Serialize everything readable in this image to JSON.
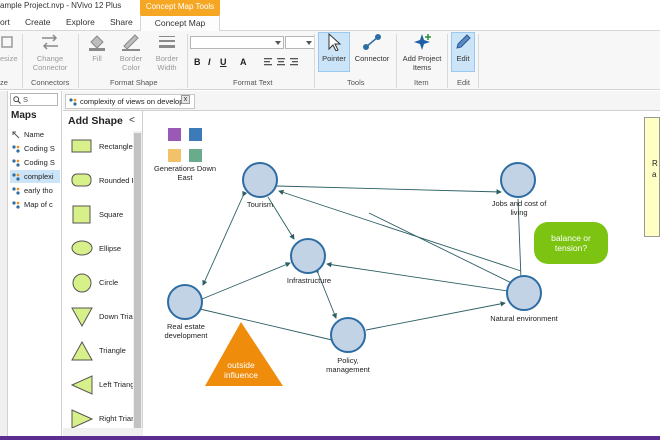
{
  "window": {
    "title": "ample Project.nvp - NVivo 12 Plus",
    "context_tab": "Concept Map Tools"
  },
  "menu": {
    "items": [
      "ort",
      "Create",
      "Explore",
      "Share"
    ],
    "active_tab": "Concept Map"
  },
  "ribbon": {
    "resize_label": "esize",
    "resize_group": "ze",
    "change_connector_label": "Change Connector",
    "connectors_group": "Connectors",
    "fill_label": "Fill",
    "border_color_label": "Border Color",
    "border_width_label": "Border Width",
    "format_shape_group": "Format Shape",
    "font_value": "",
    "size_value": "",
    "bold": "B",
    "italic": "I",
    "underline": "U",
    "font_color": "A",
    "format_text_group": "Format Text",
    "pointer_label": "Pointer",
    "connector_label": "Connector",
    "tools_group": "Tools",
    "add_items_label": "Add Project Items",
    "item_group": "Item",
    "edit_label": "Edit",
    "edit_group": "Edit"
  },
  "maps_panel": {
    "search_value": "S",
    "title": "Maps",
    "header": "Name",
    "rows": [
      {
        "label": "Coding S",
        "selected": false
      },
      {
        "label": "Coding S",
        "selected": false
      },
      {
        "label": "complexi",
        "selected": true
      },
      {
        "label": "early tho",
        "selected": false
      },
      {
        "label": "Map of c",
        "selected": false
      }
    ]
  },
  "doc_tab": {
    "label": "complexity of views on developm",
    "close": "x"
  },
  "shape_panel": {
    "title": "Add Shape",
    "collapse": "<",
    "items": [
      "Rectangle",
      "Rounded R",
      "Square",
      "Ellipse",
      "Circle",
      "Down Trian",
      "Triangle",
      "Left Triang",
      "Right Triang"
    ]
  },
  "map": {
    "legend_label": "Generations Down East",
    "legend_colors": [
      "#9b59b6",
      "#3d7ab8",
      "#f2c26b",
      "#6aab8e"
    ],
    "nodes": {
      "tourism": "Tourism",
      "jobs": "Jobs and cost of living",
      "infrastructure": "Infrastructure",
      "real_estate": "Real estate development",
      "policy": "Policy, management",
      "natural": "Natural environment"
    },
    "balance_text": "balance or tension?",
    "outside_text": "outside influence",
    "note_text": "R a"
  },
  "colors": {
    "node_fill": "#c3d3e6",
    "node_stroke": "#2e6da4",
    "edge": "#2d5f64",
    "balance_fill": "#7cc411",
    "outside_fill": "#f08c0c",
    "ribbon_active": "#cce4f7",
    "bottom_strip": "#5c2d91"
  }
}
